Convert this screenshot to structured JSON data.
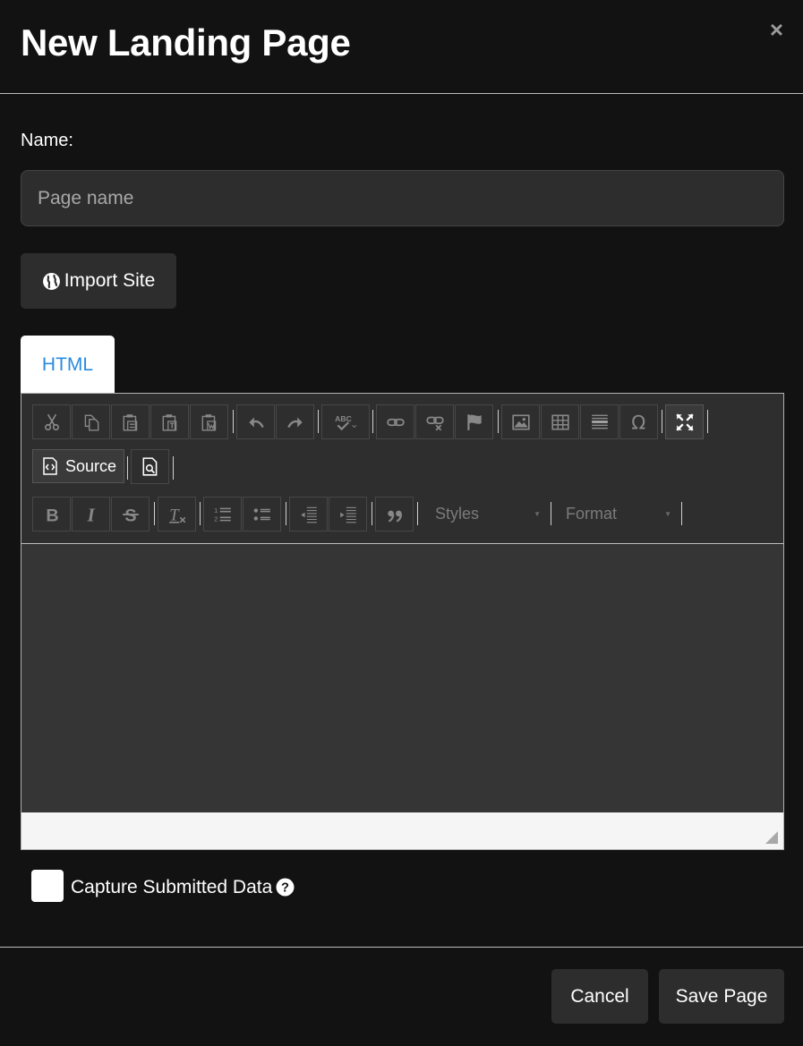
{
  "modal": {
    "title": "New Landing Page",
    "close_glyph": "×"
  },
  "form": {
    "name_label": "Name:",
    "name_placeholder": "Page name",
    "name_value": "",
    "import_label": "Import Site",
    "import_icon": "globe-icon"
  },
  "tabs": [
    {
      "label": "HTML",
      "active": true
    }
  ],
  "editor": {
    "toolbar_row1": [
      "cut",
      "copy",
      "paste",
      "paste-as-text",
      "paste-from-word",
      "undo",
      "redo",
      "spellcheck",
      "link",
      "unlink",
      "anchor",
      "image",
      "table",
      "horizontal-line",
      "special-character",
      "maximize"
    ],
    "source_label": "Source",
    "toolbar_row3": [
      "bold",
      "italic",
      "strikethrough",
      "remove-format",
      "numbered-list",
      "bulleted-list",
      "decrease-indent",
      "increase-indent",
      "blockquote"
    ],
    "styles_label": "Styles",
    "format_label": "Format",
    "content": ""
  },
  "capture": {
    "label": "Capture Submitted Data",
    "checked": false
  },
  "footer": {
    "cancel_label": "Cancel",
    "save_label": "Save Page"
  },
  "colors": {
    "background": "#121212",
    "input_bg": "#2d2d2d",
    "tab_active_text": "#2a8be0",
    "editor_bg": "#353535"
  }
}
